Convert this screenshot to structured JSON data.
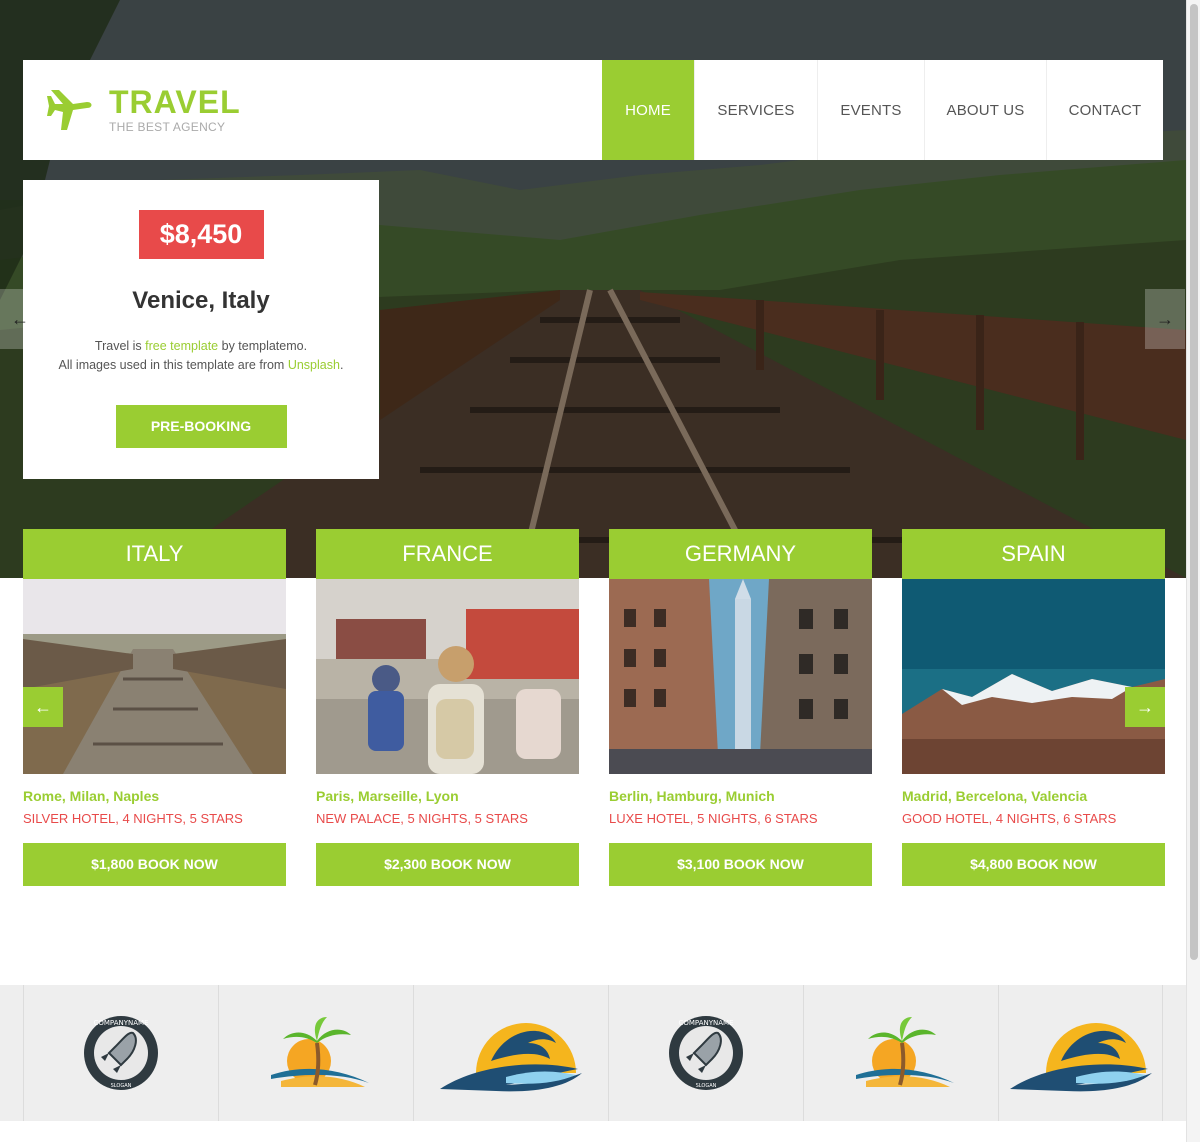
{
  "header": {
    "brand_title": "TRAVEL",
    "brand_subtitle": "THE BEST AGENCY",
    "nav": [
      {
        "label": "HOME",
        "active": true
      },
      {
        "label": "SERVICES",
        "active": false
      },
      {
        "label": "EVENTS",
        "active": false
      },
      {
        "label": "ABOUT US",
        "active": false
      },
      {
        "label": "CONTACT",
        "active": false
      }
    ]
  },
  "booking": {
    "price": "$8,450",
    "city": "Venice, Italy",
    "desc_1a": "Travel is ",
    "desc_1link": "free template",
    "desc_1b": " by templatemo.",
    "desc_2a": "All images used in this template are from ",
    "desc_2link": "Unsplash",
    "desc_2b": ".",
    "button": "PRE-BOOKING"
  },
  "hero_arrows": {
    "prev": "←",
    "next": "→"
  },
  "destinations": [
    {
      "country": "ITALY",
      "cities": "Rome, Milan, Naples",
      "info": "SILVER HOTEL, 4 NIGHTS, 5 STARS",
      "button": "$1,800 BOOK NOW"
    },
    {
      "country": "FRANCE",
      "cities": "Paris, Marseille, Lyon",
      "info": "NEW PALACE, 5 NIGHTS, 5 STARS",
      "button": "$2,300 BOOK NOW"
    },
    {
      "country": "GERMANY",
      "cities": "Berlin, Hamburg, Munich",
      "info": "LUXE HOTEL, 5 NIGHTS, 6 STARS",
      "button": "$3,100 BOOK NOW"
    },
    {
      "country": "SPAIN",
      "cities": "Madrid, Bercelona, Valencia",
      "info": "GOOD HOTEL, 4 NIGHTS, 6 STARS",
      "button": "$4,800 BOOK NOW"
    }
  ],
  "dest_arrows": {
    "prev": "←",
    "next": "→"
  },
  "logos": [
    {
      "icon": "rocket-badge-logo",
      "text_top": "COMPANYNAME",
      "text_bottom": "SLOGAN"
    },
    {
      "icon": "palm-island-logo"
    },
    {
      "icon": "dolphin-wave-logo"
    },
    {
      "icon": "rocket-badge-logo",
      "text_top": "COMPANYNAME",
      "text_bottom": "SLOGAN"
    },
    {
      "icon": "palm-island-logo"
    },
    {
      "icon": "dolphin-wave-logo"
    }
  ],
  "colors": {
    "accent": "#9acd32",
    "price": "#e84a4a",
    "text": "#333333"
  }
}
